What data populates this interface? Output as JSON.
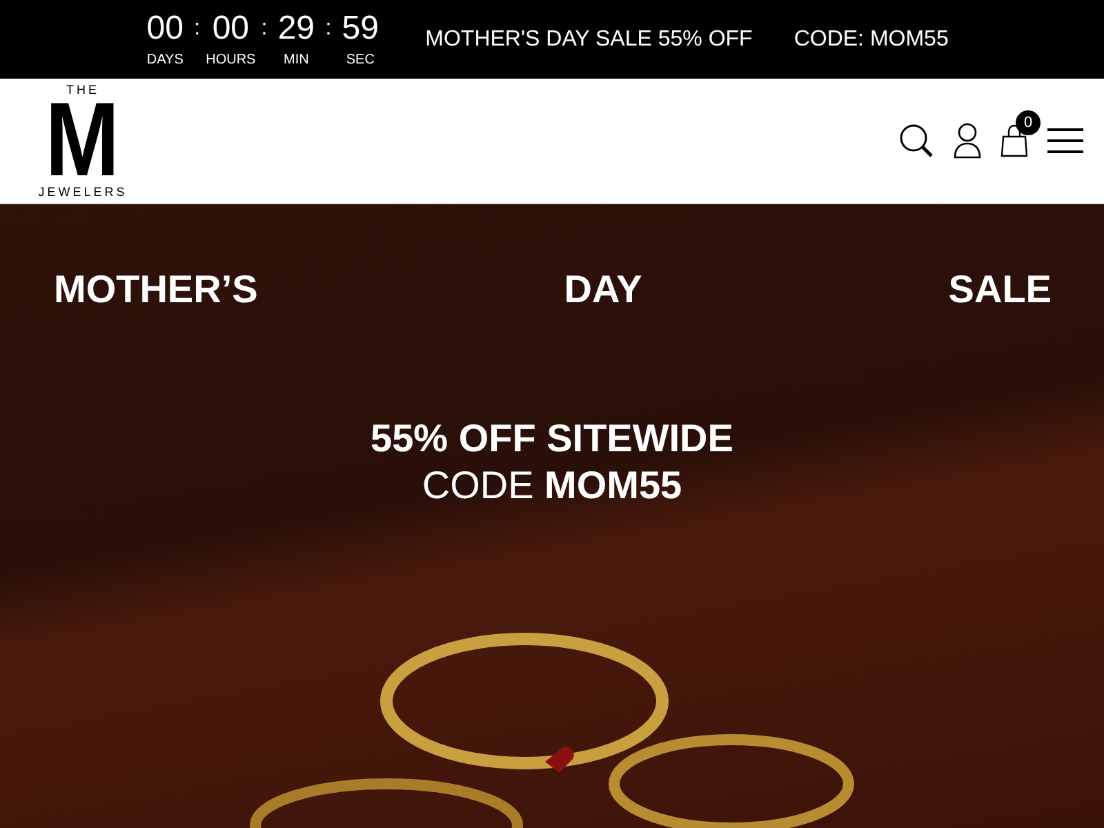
{
  "announcement": {
    "countdown": [
      {
        "value": "00",
        "unit": "DAYS"
      },
      {
        "value": "00",
        "unit": "HOURS"
      },
      {
        "value": "29",
        "unit": "MIN"
      },
      {
        "value": "59",
        "unit": "SEC"
      }
    ],
    "separator": ":",
    "message": "MOTHER'S DAY SALE 55% OFF",
    "code": "CODE: MOM55"
  },
  "header": {
    "logo": {
      "top": "THE",
      "letter": "M",
      "bottom": "JEWELERS"
    },
    "cart_count": "0"
  },
  "hero": {
    "headline": [
      "MOTHER’S",
      "DAY",
      "SALE"
    ],
    "offer": "55% OFF SITEWIDE",
    "code": "CODE **MOM55**"
  }
}
